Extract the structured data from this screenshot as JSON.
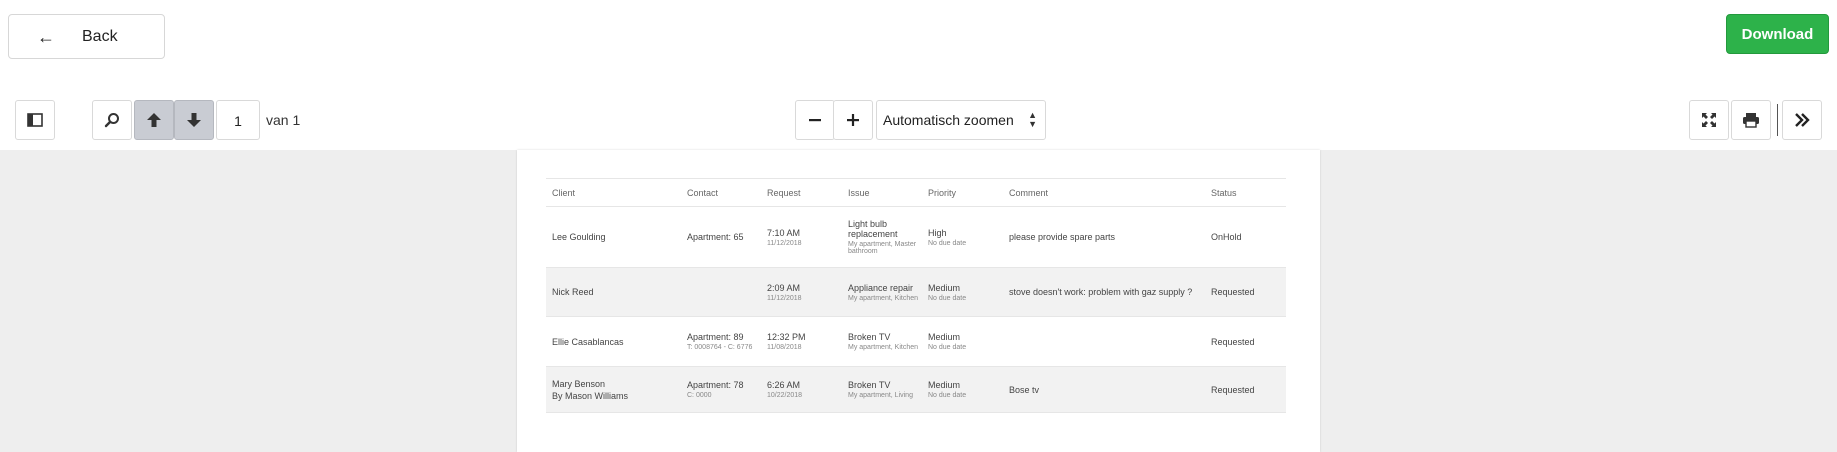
{
  "header": {
    "back_label": "Back",
    "download_label": "Download",
    "accent_color": "#2db24a"
  },
  "toolbar": {
    "page_number": "1",
    "page_of": "van 1",
    "zoom_label": "Automatisch zoomen",
    "icons": [
      "sidebar-toggle-icon",
      "search-icon",
      "arrow-up-icon",
      "arrow-down-icon",
      "minus-icon",
      "plus-icon",
      "fullscreen-icon",
      "print-icon",
      "double-chevron-right-icon"
    ]
  },
  "table": {
    "headers": [
      "Client",
      "Contact",
      "Request",
      "Issue",
      "Priority",
      "Comment",
      "Status"
    ],
    "rows": [
      {
        "client": "Lee Goulding",
        "client2": "",
        "contact": "Apartment: 65",
        "contact_sub": "",
        "request_time": "7:10 AM",
        "request_date": "11/12/2018",
        "issue": "Light bulb replacement",
        "issue_sub": "My apartment, Master bathroom",
        "priority": "High",
        "priority_sub": "No due date",
        "comment": "please provide spare parts",
        "status": "OnHold"
      },
      {
        "client": "Nick Reed",
        "client2": "",
        "contact": "",
        "contact_sub": "",
        "request_time": "2:09 AM",
        "request_date": "11/12/2018",
        "issue": "Appliance repair",
        "issue_sub": "My apartment, Kitchen",
        "priority": "Medium",
        "priority_sub": "No due date",
        "comment": "stove doesn't work: problem with gaz supply ?",
        "status": "Requested"
      },
      {
        "client": "Ellie Casablancas",
        "client2": "",
        "contact": "Apartment: 89",
        "contact_sub": "T: 0008764 - C: 6776",
        "request_time": "12:32 PM",
        "request_date": "11/08/2018",
        "issue": "Broken TV",
        "issue_sub": "My apartment, Kitchen",
        "priority": "Medium",
        "priority_sub": "No due date",
        "comment": "",
        "status": "Requested"
      },
      {
        "client": "Mary Benson",
        "client2": "By Mason Williams",
        "contact": "Apartment: 78",
        "contact_sub": "C: 0000",
        "request_time": "6:26 AM",
        "request_date": "10/22/2018",
        "issue": "Broken TV",
        "issue_sub": "My apartment, Living",
        "priority": "Medium",
        "priority_sub": "No due date",
        "comment": "Bose tv",
        "status": "Requested"
      }
    ]
  }
}
